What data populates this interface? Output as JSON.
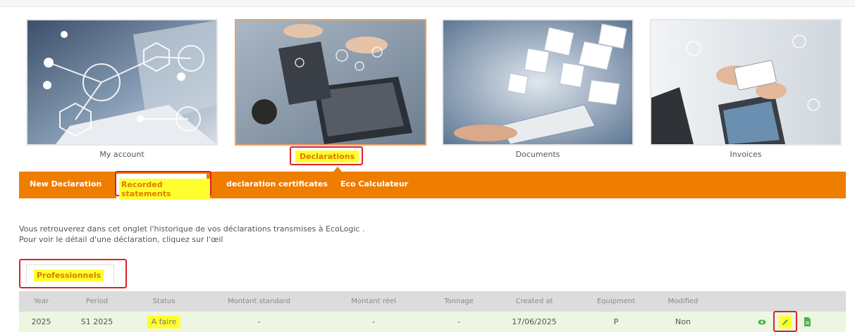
{
  "tiles": [
    {
      "id": "account",
      "label": "My account"
    },
    {
      "id": "declarations",
      "label": "Declarations"
    },
    {
      "id": "documents",
      "label": "Documents"
    },
    {
      "id": "invoices",
      "label": "Invoices"
    }
  ],
  "tabs": [
    {
      "label": "New Declaration"
    },
    {
      "label": "Recorded statements",
      "selected": true
    },
    {
      "label": "declaration certificates"
    },
    {
      "label": "Eco Calculateur"
    }
  ],
  "info": {
    "line1": "Vous retrouverez dans cet onglet l'historique de vos déclarations transmises à EcoLogic .",
    "line2": "Pour voir le détail d'une déclaration, cliquez sur l'œil"
  },
  "subtab": {
    "label": "Professionnels"
  },
  "table": {
    "headers": [
      "Year",
      "Period",
      "Status",
      "Montant standard",
      "Montant réel",
      "Tonnage",
      "Created at",
      "Equipment",
      "Modified"
    ],
    "rows": [
      {
        "year": "2025",
        "period": "S1 2025",
        "status": "A faire",
        "montant_standard": "-",
        "montant_reel": "-",
        "tonnage": "-",
        "created_at": "17/06/2025",
        "equipment": "P",
        "modified": "Non"
      }
    ]
  },
  "colors": {
    "brand_orange": "#ef7d00",
    "highlight_yellow": "#ffff30",
    "annotation_red": "#d8232a",
    "row_green": "#edf6e0",
    "action_green": "#4caf50"
  },
  "icons": {
    "view": "eye-icon",
    "edit": "pencil-icon",
    "export": "document-icon"
  }
}
